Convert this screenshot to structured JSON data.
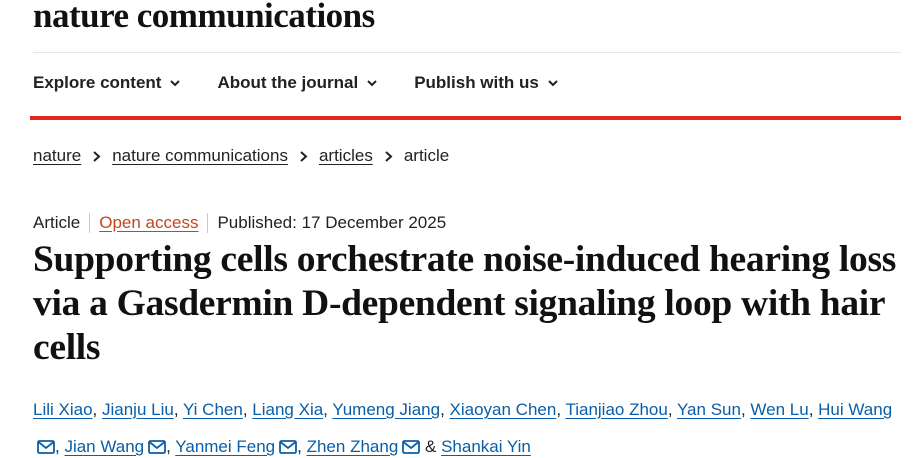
{
  "brand": "nature communications",
  "nav": [
    {
      "label": "Explore content",
      "icon": "chevron-down-icon"
    },
    {
      "label": "About the journal",
      "icon": "chevron-down-icon"
    },
    {
      "label": "Publish with us",
      "icon": "chevron-down-icon"
    }
  ],
  "breadcrumb": [
    "nature",
    "nature communications",
    "articles",
    "article"
  ],
  "meta": {
    "type": "Article",
    "access": "Open access",
    "published": "Published: 17 December 2025"
  },
  "title": "Supporting cells orchestrate noise-induced hearing loss via a Gasdermin D-dependent signaling loop with hair cells",
  "authors": [
    {
      "name": "Lili Xiao",
      "sep": ", "
    },
    {
      "name": "Jianju Liu",
      "sep": ", "
    },
    {
      "name": "Yi Chen",
      "sep": ", "
    },
    {
      "name": "Liang Xia",
      "sep": ", "
    },
    {
      "name": "Yumeng Jiang",
      "sep": ", "
    },
    {
      "name": "Xiaoyan Chen",
      "sep": ", "
    },
    {
      "name": "Tianjiao Zhou",
      "sep": ", "
    },
    {
      "name": "Yan Sun",
      "sep": ", "
    },
    {
      "name": "Wen Lu",
      "sep": ", "
    },
    {
      "name": "Hui Wang",
      "sep": ", ",
      "email_icon": "envelope-icon"
    },
    {
      "name": "Jian Wang",
      "sep": ", ",
      "email_icon": "envelope-icon"
    },
    {
      "name": "Yanmei Feng",
      "sep": ", ",
      "email_icon": "envelope-icon"
    },
    {
      "name": "Zhen Zhang",
      "sep": " & ",
      "email_icon": "envelope-icon"
    },
    {
      "name": "Shankai Yin",
      "sep": ""
    }
  ],
  "colors": {
    "accent_red": "#e0281f",
    "author_link": "#0a5ea8",
    "open_access": "#c4461f"
  }
}
